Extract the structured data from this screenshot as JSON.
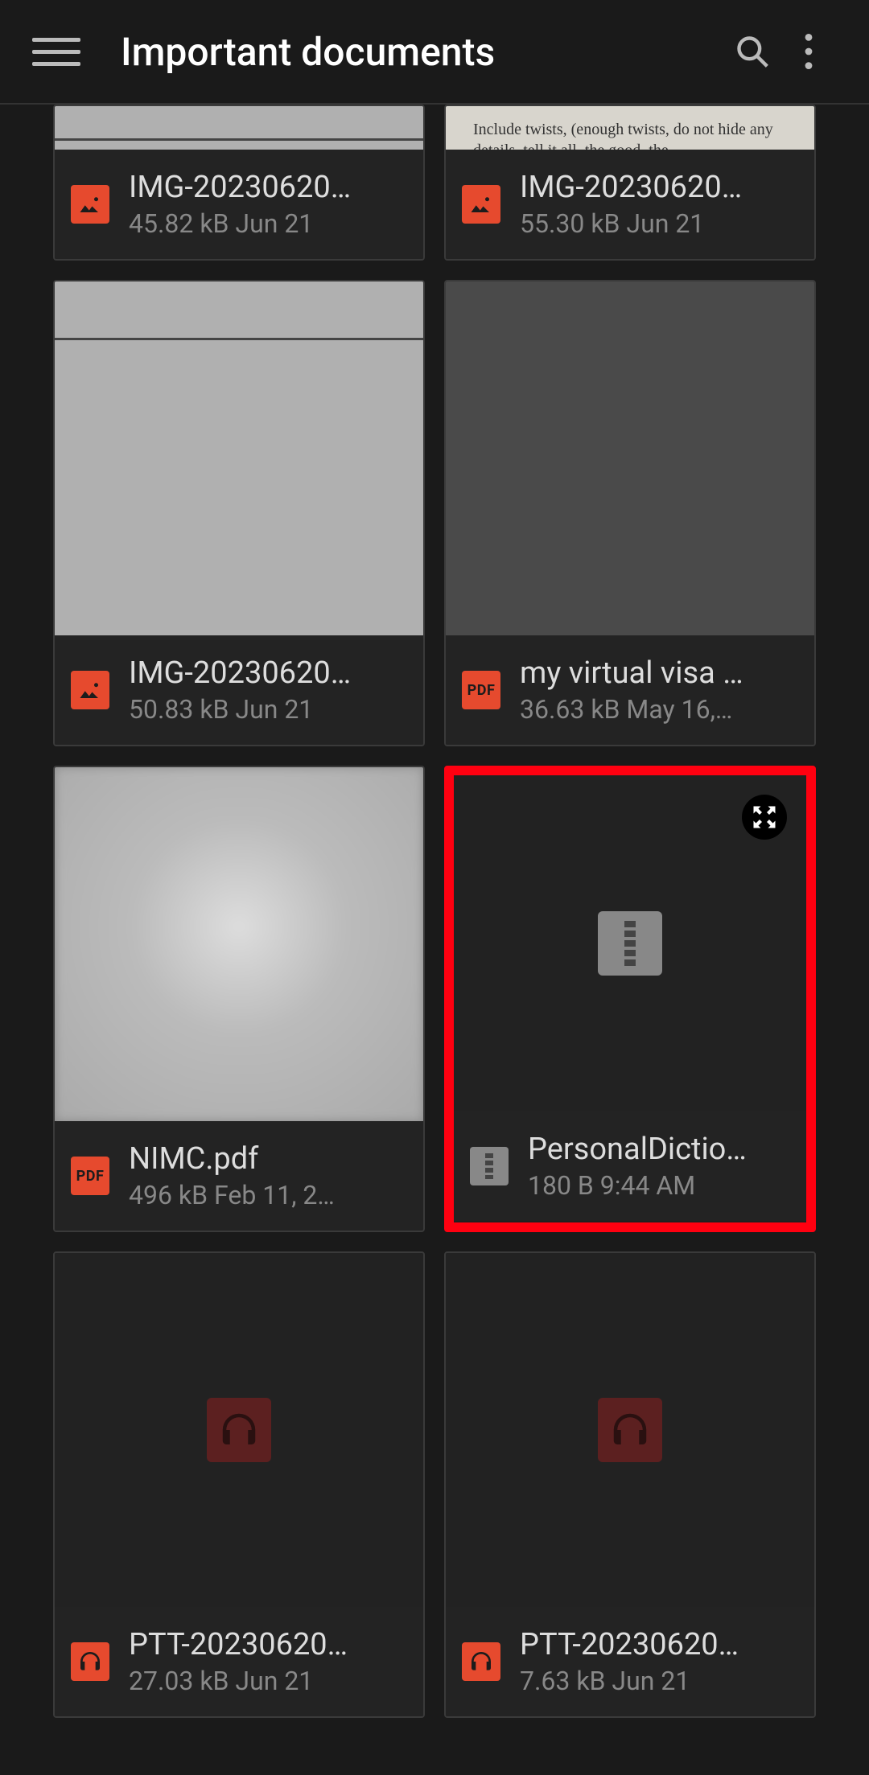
{
  "header": {
    "title": "Important documents"
  },
  "files": [
    {
      "name": "IMG-20230620…",
      "meta": "45.82 kB  Jun 21",
      "type": "image",
      "thumb": "doc_lined",
      "row": 0
    },
    {
      "name": "IMG-20230620…",
      "meta": "55.30 kB  Jun 21",
      "type": "image",
      "thumb": "text_preview",
      "preview_text": "Include twists, (enough twists, do not hide any details, tell it all, the good, the",
      "row": 0
    },
    {
      "name": "IMG-20230620…",
      "meta": "50.83 kB  Jun 21",
      "type": "image",
      "thumb": "doc",
      "row": 1
    },
    {
      "name": "my virtual visa …",
      "meta": "36.63 kB  May 16,…",
      "type": "pdf",
      "thumb": "blank_semi",
      "row": 1
    },
    {
      "name": "NIMC.pdf",
      "meta": "496 kB  Feb 11, 2…",
      "type": "pdf",
      "thumb": "blur",
      "row": 2
    },
    {
      "name": "PersonalDictio…",
      "meta": "180 B  9:44 AM",
      "type": "zip",
      "thumb": "zip_dark",
      "row": 2,
      "highlighted": true,
      "expand": true
    },
    {
      "name": "PTT-20230620…",
      "meta": "27.03 kB  Jun 21",
      "type": "audio",
      "thumb": "audio_dark",
      "row": 3
    },
    {
      "name": "PTT-20230620…",
      "meta": "7.63 kB  Jun 21",
      "type": "audio",
      "thumb": "audio_dark",
      "row": 3
    }
  ]
}
